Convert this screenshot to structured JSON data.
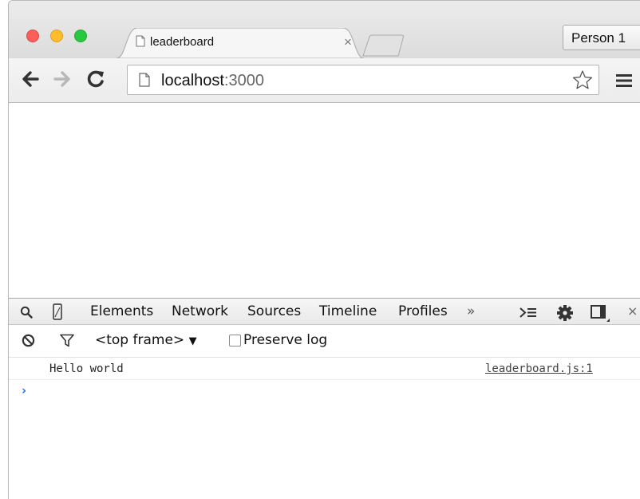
{
  "browser": {
    "tab": {
      "title": "leaderboard",
      "close_glyph": "×"
    },
    "profile_label": "Person 1",
    "url_host": "localhost",
    "url_port": ":3000",
    "icons": [
      "back-arrow-icon",
      "forward-arrow-icon",
      "reload-icon",
      "page-icon",
      "star-icon",
      "menu-icon"
    ]
  },
  "devtools": {
    "tabs": [
      "Elements",
      "Network",
      "Sources",
      "Timeline",
      "Profiles"
    ],
    "overflow_glyph": "»",
    "close_glyph": "×",
    "frame_selector": "<top frame>",
    "frame_caret": "▼",
    "preserve_log_label": "Preserve log",
    "preserve_log_checked": false,
    "console": {
      "messages": [
        {
          "text": "Hello world",
          "source": "leaderboard.js:1"
        }
      ],
      "prompt_glyph": "›"
    },
    "colors": {
      "prompt": "#2f6fe0"
    }
  }
}
